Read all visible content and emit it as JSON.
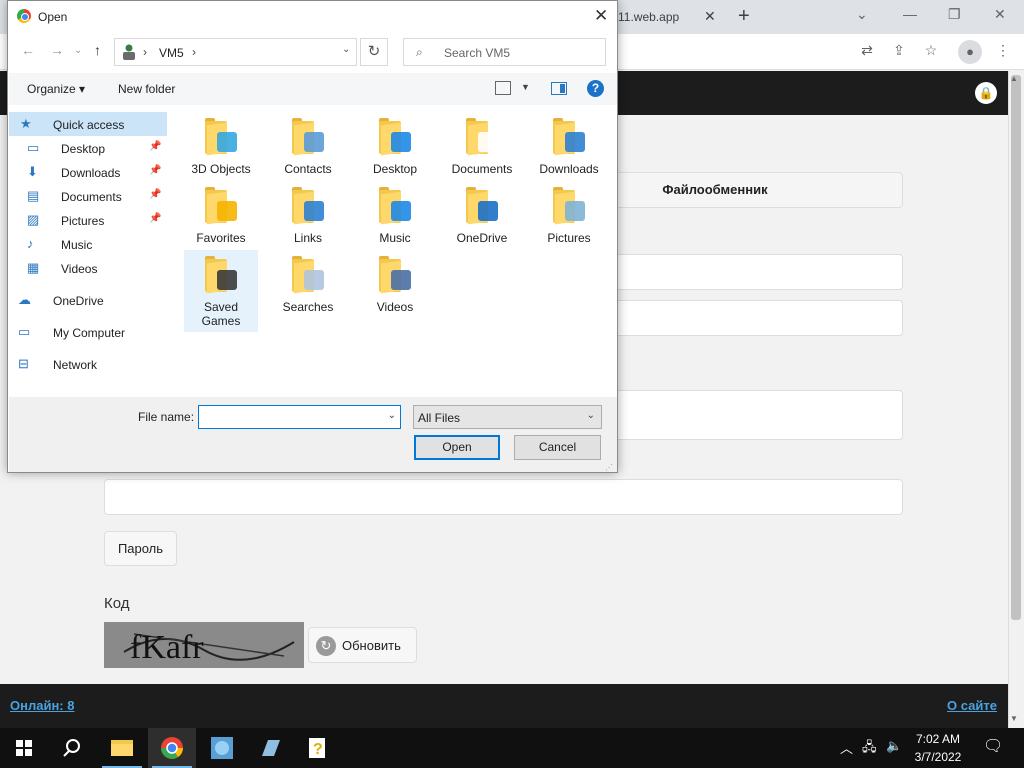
{
  "browser": {
    "tab_title": "11.web.app",
    "tab_close": "✕",
    "new_tab": "+",
    "controls": {
      "tab_list": "⌄",
      "minimize": "—",
      "restore": "❐",
      "close": "✕"
    }
  },
  "site": {
    "tab_fileshare": "Файлообменник",
    "password_button": "Пароль",
    "code_label": "Код",
    "captcha_text": "fKafr",
    "refresh_button": "Обновить",
    "footer_online": "Онлайн: 8",
    "footer_about": "О сайте"
  },
  "dialog": {
    "title": "Open",
    "path": [
      "VM5"
    ],
    "search_placeholder": "Search VM5",
    "organize_label": "Organize",
    "new_folder_label": "New folder",
    "help": "?",
    "nav_items": [
      {
        "label": "Quick access",
        "icon": "star-icon"
      },
      {
        "label": "Desktop",
        "icon": "desktop-icon",
        "pinned": true
      },
      {
        "label": "Downloads",
        "icon": "download-icon",
        "pinned": true
      },
      {
        "label": "Documents",
        "icon": "documents-icon",
        "pinned": true
      },
      {
        "label": "Pictures",
        "icon": "pictures-icon",
        "pinned": true
      },
      {
        "label": "Music",
        "icon": "music-icon"
      },
      {
        "label": "Videos",
        "icon": "videos-icon"
      },
      {
        "label": "OneDrive",
        "icon": "cloud-icon"
      },
      {
        "label": "My Computer",
        "icon": "computer-icon"
      },
      {
        "label": "Network",
        "icon": "network-icon"
      }
    ],
    "folders": [
      {
        "label": "3D Objects",
        "overlay": "#35a7e0"
      },
      {
        "label": "Contacts",
        "overlay": "#5b9bd5"
      },
      {
        "label": "Desktop",
        "overlay": "#1e88e5"
      },
      {
        "label": "Documents",
        "overlay": "#ffffff"
      },
      {
        "label": "Downloads",
        "overlay": "#2f80d1"
      },
      {
        "label": "Favorites",
        "overlay": "#f5b400"
      },
      {
        "label": "Links",
        "overlay": "#2f80d1"
      },
      {
        "label": "Music",
        "overlay": "#1e88e5"
      },
      {
        "label": "OneDrive",
        "overlay": "#1c6fc7"
      },
      {
        "label": "Pictures",
        "overlay": "#7fb3d5"
      },
      {
        "label": "Saved Games",
        "overlay": "#3a3a3a"
      },
      {
        "label": "Searches",
        "overlay": "#b0c4de"
      },
      {
        "label": "Videos",
        "overlay": "#4a6fa5"
      }
    ],
    "filename_label": "File name:",
    "filename_value": "",
    "filetype_value": "All Files",
    "open_button": "Open",
    "cancel_button": "Cancel"
  },
  "taskbar": {
    "time": "7:02 AM",
    "date": "3/7/2022",
    "accent": "#76b9ed"
  }
}
